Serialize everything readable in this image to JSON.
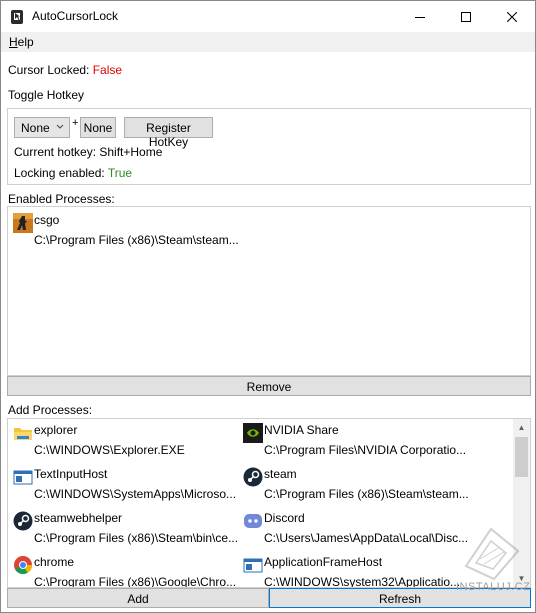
{
  "window": {
    "title": "AutoCursorLock"
  },
  "menu": {
    "help": "Help",
    "help_mnemonic": "H",
    "help_rest": "elp"
  },
  "status": {
    "cursor_locked_label": "Cursor Locked: ",
    "cursor_locked_value": "False"
  },
  "hotkey": {
    "section_label": "Toggle Hotkey",
    "modifier_selected": "None",
    "plus": "+",
    "key_button": "None",
    "register_button": "Register HotKey",
    "current_hotkey": "Current hotkey: Shift+Home",
    "locking_label": "Locking enabled: ",
    "locking_value": "True"
  },
  "enabled": {
    "section_label": "Enabled Processes:",
    "items": [
      {
        "name": "csgo",
        "path": "C:\\Program Files (x86)\\Steam\\steam...",
        "icon": "csgo-icon"
      }
    ],
    "remove_button": "Remove"
  },
  "add": {
    "section_label": "Add Processes:",
    "items": [
      {
        "name": "explorer",
        "path": "C:\\WINDOWS\\Explorer.EXE",
        "icon": "folder-icon"
      },
      {
        "name": "NVIDIA Share",
        "path": "C:\\Program Files\\NVIDIA Corporatio...",
        "icon": "nvidia-icon"
      },
      {
        "name": "TextInputHost",
        "path": "C:\\WINDOWS\\SystemApps\\Microso...",
        "icon": "window-app-icon"
      },
      {
        "name": "steam",
        "path": "C:\\Program Files (x86)\\Steam\\steam...",
        "icon": "steam-icon"
      },
      {
        "name": "steamwebhelper",
        "path": "C:\\Program Files (x86)\\Steam\\bin\\ce...",
        "icon": "steam-icon"
      },
      {
        "name": "Discord",
        "path": "C:\\Users\\James\\AppData\\Local\\Disc...",
        "icon": "discord-icon"
      },
      {
        "name": "chrome",
        "path": "C:\\Program Files (x86)\\Google\\Chro...",
        "icon": "chrome-icon"
      },
      {
        "name": "ApplicationFrameHost",
        "path": "C:\\WINDOWS\\system32\\Applicatio...",
        "icon": "window-app-icon"
      }
    ],
    "add_button": "Add",
    "refresh_button": "Refresh"
  },
  "watermark": {
    "text": "INSTALUJ.CZ"
  }
}
